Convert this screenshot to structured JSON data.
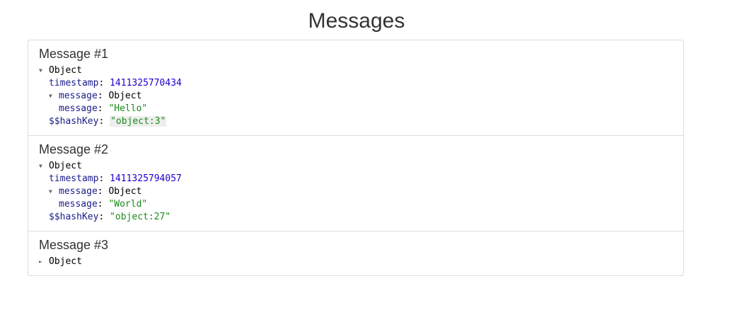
{
  "page": {
    "title": "Messages"
  },
  "messages": [
    {
      "heading": "Message #1",
      "expanded": true,
      "root_label": "Object",
      "timestamp_key": "timestamp",
      "timestamp_value": "1411325770434",
      "message_key": "message",
      "message_obj_label": "Object",
      "message_inner_key": "message",
      "message_inner_value": "\"Hello\"",
      "hashkey_key": "$$hashKey",
      "hashkey_value": "\"object:3\""
    },
    {
      "heading": "Message #2",
      "expanded": true,
      "root_label": "Object",
      "timestamp_key": "timestamp",
      "timestamp_value": "1411325794057",
      "message_key": "message",
      "message_obj_label": "Object",
      "message_inner_key": "message",
      "message_inner_value": "\"World\"",
      "hashkey_key": "$$hashKey",
      "hashkey_value": "\"object:27\""
    },
    {
      "heading": "Message #3",
      "expanded": false,
      "root_label": "Object"
    }
  ],
  "icons": {
    "expanded": "triangle-down-icon",
    "collapsed": "triangle-right-icon"
  },
  "colors": {
    "key": "#1a1a8a",
    "number": "#1c00cf",
    "string": "#1a8a1a",
    "border": "#dddddd",
    "text": "#333333"
  }
}
